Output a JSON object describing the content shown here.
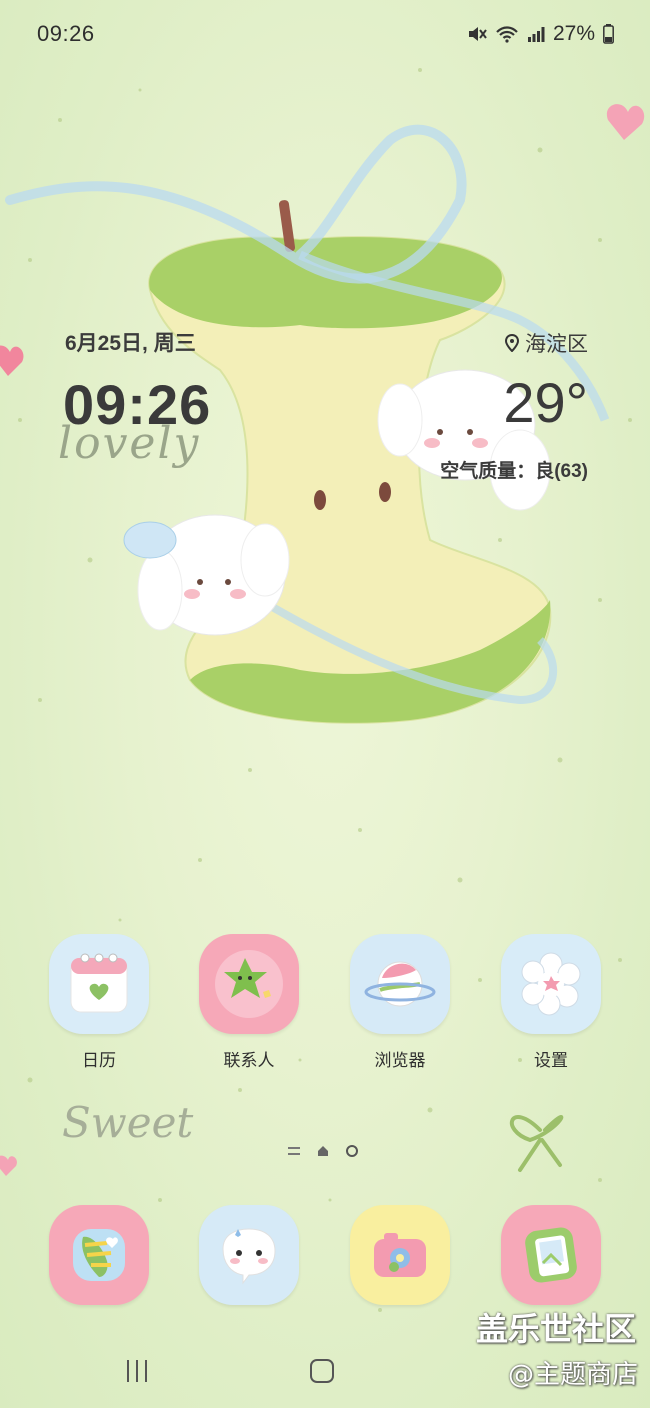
{
  "status_bar": {
    "time": "09:26",
    "battery": "27%"
  },
  "widget": {
    "date": "6月25日, 周三",
    "time": "09:26",
    "location": "海淀区",
    "temperature": "29°",
    "air_quality": "空气质量：良(63)"
  },
  "apps": [
    {
      "label": "日历",
      "icon": "calendar-icon"
    },
    {
      "label": "联系人",
      "icon": "contacts-star-icon"
    },
    {
      "label": "浏览器",
      "icon": "planet-browser-icon"
    },
    {
      "label": "设置",
      "icon": "flower-settings-icon"
    }
  ],
  "dock": [
    {
      "icon": "phone-icon"
    },
    {
      "icon": "messages-icon"
    },
    {
      "icon": "camera-icon"
    },
    {
      "icon": "gallery-icon"
    }
  ],
  "wallpaper_text": {
    "lovely": "lovely",
    "sweet": "Sweet"
  },
  "watermark": {
    "line1": "盖乐世社区",
    "line2": "@主题商店"
  },
  "colors": {
    "background": "#e6f1cf",
    "apple_green": "#9ccc5a",
    "ribbon_blue": "#bcdcf2",
    "pink": "#f3a6b7"
  }
}
